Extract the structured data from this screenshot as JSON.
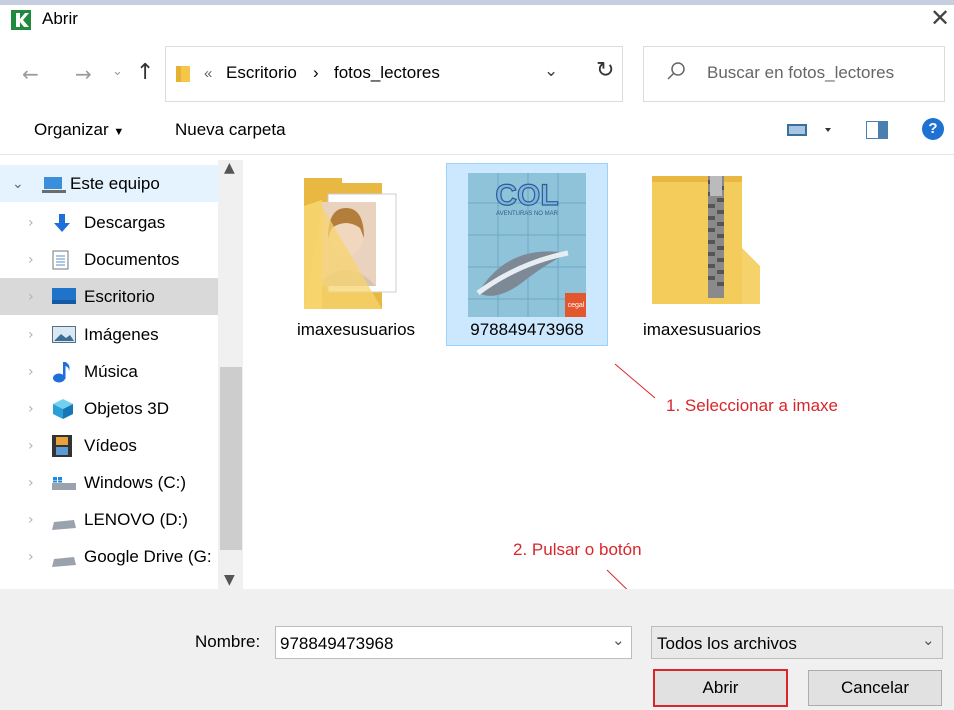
{
  "window": {
    "title": "Abrir"
  },
  "address_bar": {
    "overflow": "«",
    "breadcrumb": [
      "Escritorio",
      "fotos_lectores"
    ],
    "separator": "›"
  },
  "search": {
    "placeholder": "Buscar en fotos_lectores"
  },
  "toolbar": {
    "organize": "Organizar",
    "new_folder": "Nueva carpeta"
  },
  "sidebar": {
    "items": [
      {
        "label": "Este equipo",
        "icon": "computer-icon"
      },
      {
        "label": "Descargas",
        "icon": "download-icon"
      },
      {
        "label": "Documentos",
        "icon": "document-icon"
      },
      {
        "label": "Escritorio",
        "icon": "desktop-icon"
      },
      {
        "label": "Imágenes",
        "icon": "pictures-icon"
      },
      {
        "label": "Música",
        "icon": "music-icon"
      },
      {
        "label": "Objetos 3D",
        "icon": "cube-icon"
      },
      {
        "label": "Vídeos",
        "icon": "video-icon"
      },
      {
        "label": "Windows (C:)",
        "icon": "drive-icon"
      },
      {
        "label": "LENOVO (D:)",
        "icon": "drive-icon"
      },
      {
        "label": "Google Drive (G:",
        "icon": "drive-icon"
      }
    ]
  },
  "files": [
    {
      "name": "imaxesusuarios",
      "type": "folder-with-photo"
    },
    {
      "name": "978849473968",
      "type": "image",
      "selected": true,
      "thumb_title": "COL",
      "thumb_subtitle": "AVENTURAS NO MAR",
      "thumb_brand": "cegal"
    },
    {
      "name": "imaxesusuarios",
      "type": "zip-folder"
    }
  ],
  "annotations": {
    "step1": "1. Seleccionar a imaxe",
    "step2": "2. Pulsar o botón"
  },
  "bottom": {
    "name_label": "Nombre:",
    "name_value": "978849473968",
    "filter_value": "Todos los archivos",
    "open_label": "Abrir",
    "cancel_label": "Cancelar"
  },
  "colors": {
    "accent": "#0078d7",
    "selection": "#cce8ff",
    "annotation": "#d9262a"
  }
}
